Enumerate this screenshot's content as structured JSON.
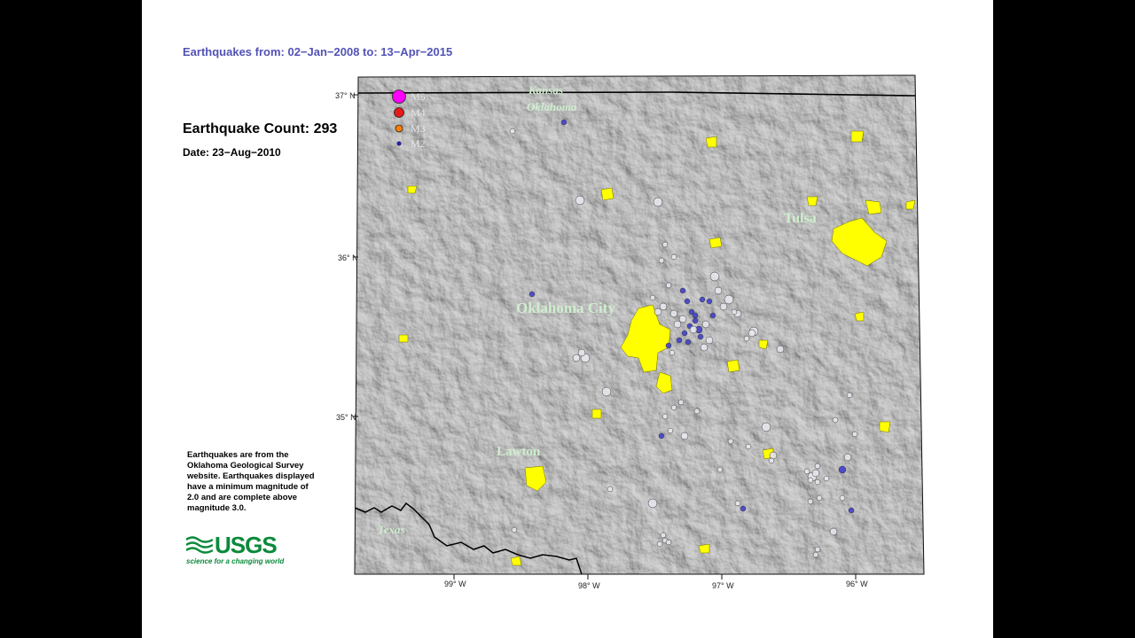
{
  "header": {
    "range_title": "Earthquakes from: 02−Jan−2008 to: 13−Apr−2015"
  },
  "stats": {
    "count_label": "Earthquake Count: 293",
    "date_label": "Date: 23−Aug−2010"
  },
  "source_note": "Earthquakes are from the Oklahoma Geological Survey website. Earthquakes displayed have a minimum magnitude of 2.0 and are complete above magnitude 3.0.",
  "logo": {
    "word": "USGS",
    "tagline": "science for a changing world",
    "color": "#0a8a3a"
  },
  "map": {
    "lat_labels": [
      "37° N",
      "36° N",
      "35° N"
    ],
    "lon_labels": [
      "99° W",
      "98° W",
      "97° W",
      "96° W"
    ],
    "state_labels": {
      "kansas": "Kansas",
      "oklahoma": "Oklahoma",
      "texas": "Texas"
    },
    "cities": {
      "okc": "Oklahoma City",
      "tulsa": "Tulsa",
      "lawton": "Lawton"
    },
    "legend": [
      {
        "label": "M5",
        "color": "#ff00ff"
      },
      {
        "label": "M4",
        "color": "#e41a1a"
      },
      {
        "label": "M3",
        "color": "#ff7f00"
      },
      {
        "label": "M2",
        "color": "#1e1ec8"
      }
    ],
    "colors": {
      "relief": "#8a8a8a",
      "urban": "#ffff00",
      "quake_recent": "#4040c8",
      "quake_past": "#e8e8f0"
    }
  }
}
